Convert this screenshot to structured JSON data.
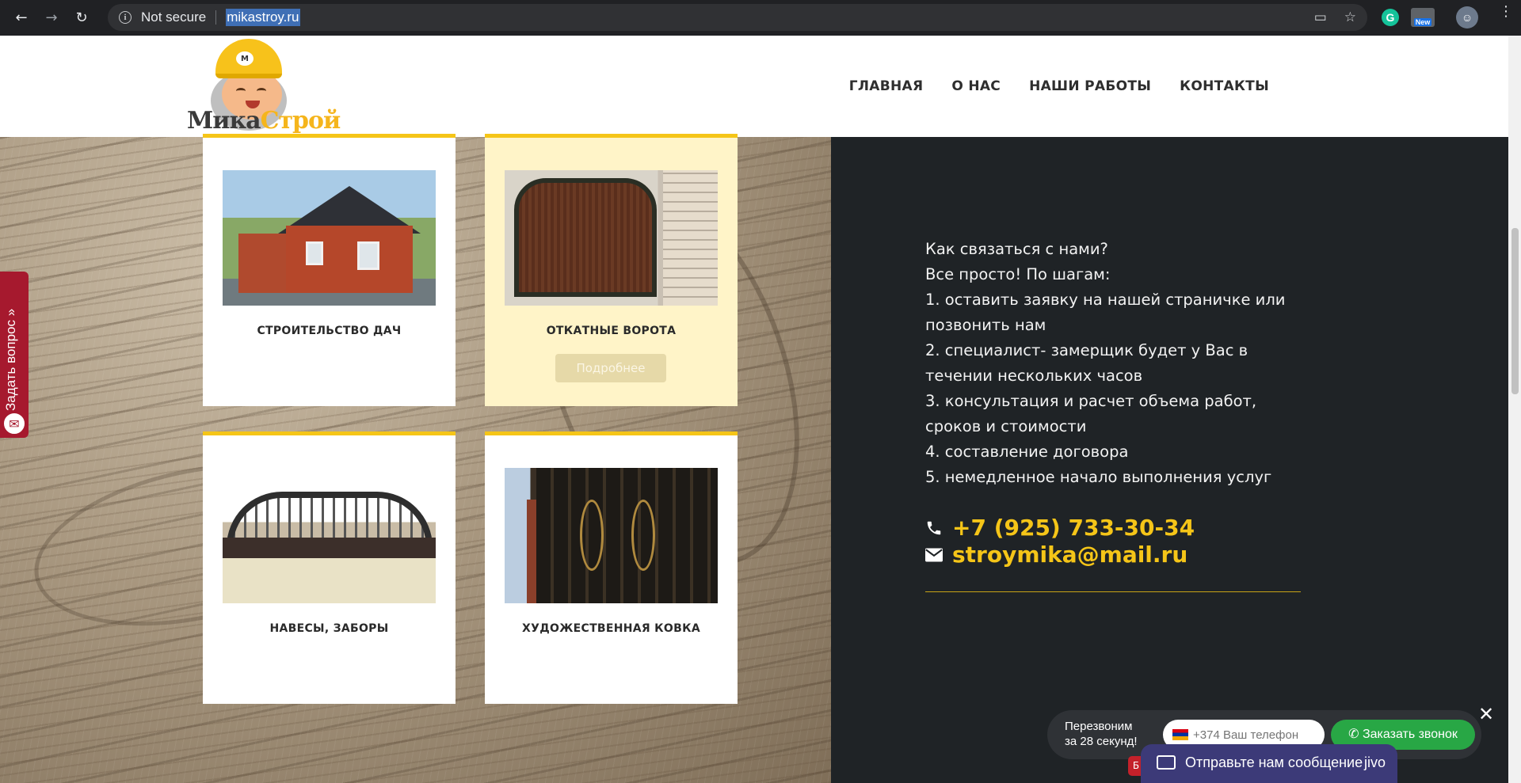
{
  "browser": {
    "security": "Not secure",
    "url": "mikastroy.ru",
    "ext_new_label": "New"
  },
  "site": {
    "logo": {
      "part1": "Мика",
      "part2": "Строй"
    },
    "menu": [
      "ГЛАВНАЯ",
      "О НАС",
      "НАШИ РАБОТЫ",
      "КОНТАКТЫ"
    ]
  },
  "cards": [
    {
      "title": "СТРОИТЕЛЬСТВО ДАЧ"
    },
    {
      "title": "ОТКАТНЫЕ ВОРОТА",
      "button": "Подробнее"
    },
    {
      "title": "НАВЕСЫ, ЗАБОРЫ"
    },
    {
      "title": "ХУДОЖЕСТВЕННАЯ КОВКА"
    }
  ],
  "contact": {
    "lines": [
      "Как связаться с нами?",
      "Все просто! По шагам:",
      "1. оставить заявку на нашей страничке или позвонить нам",
      "2. специалист- замерщик будет у Вас в течении нескольких часов",
      "3. консультация и расчет объема работ, сроков и стоимости",
      "4. составление договора",
      "5. немедленное начало выполнения услуг"
    ],
    "phone": "+7 (925) 733-30-34",
    "email": "stroymika@mail.ru"
  },
  "widgets": {
    "ask_tab": "Задать вопрос",
    "callback_label_1": "Перезвоним",
    "callback_label_2": "за 28 секунд!",
    "callback_placeholder": "+374 Ваш телефон",
    "callback_button": "Заказать звонок",
    "jivo_text": "Отправьте нам сообщение",
    "jivo_brand": "jivo",
    "badge": "Б"
  },
  "colors": {
    "accent_yellow": "#f5c518",
    "dark_panel": "#1f2326",
    "callback_green": "#28a745",
    "ask_red": "#a6192e"
  }
}
